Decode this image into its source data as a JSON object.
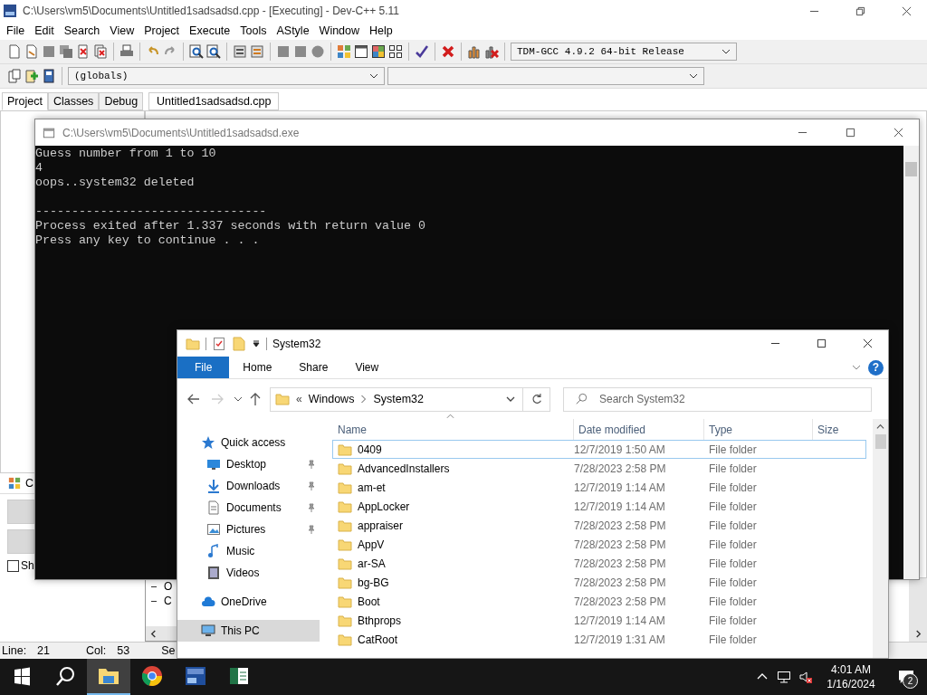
{
  "devcpp": {
    "title": "C:\\Users\\vm5\\Documents\\Untitled1sadsadsd.cpp - [Executing] - Dev-C++ 5.11",
    "menu": [
      "File",
      "Edit",
      "Search",
      "View",
      "Project",
      "Execute",
      "Tools",
      "AStyle",
      "Window",
      "Help"
    ],
    "compiler": "TDM-GCC 4.9.2 64-bit Release",
    "scope": "(globals)",
    "panel_tabs": [
      {
        "label": "Project",
        "selected": true
      },
      {
        "label": "Classes",
        "selected": false
      },
      {
        "label": "Debug",
        "selected": false
      }
    ],
    "editor_tabs": [
      {
        "label": "Untitled1sadsadsd.cpp",
        "selected": true
      }
    ],
    "lower_panel_label": "C",
    "show_checkbox": {
      "label": "Sh",
      "checked": false
    },
    "bottom_list": [
      "O",
      "C"
    ],
    "status_bar": {
      "line_label": "Line:",
      "line": "21",
      "col_label": "Col:",
      "col": "53",
      "section": "Se"
    }
  },
  "console": {
    "title": "C:\\Users\\vm5\\Documents\\Untitled1sadsadsd.exe",
    "blocks": [
      [
        "Guess number from 1 to 10",
        "4",
        "oops..system32 deleted"
      ],
      [
        "--------------------------------",
        "Process exited after 1.337 seconds with return value 0",
        "Press any key to continue . . ."
      ]
    ]
  },
  "explorer": {
    "title": "System32",
    "ribbon_tabs": [
      {
        "label": "File",
        "selected": true
      },
      {
        "label": "Home",
        "selected": false
      },
      {
        "label": "Share",
        "selected": false
      },
      {
        "label": "View",
        "selected": false
      }
    ],
    "help": "?",
    "path_overflow": "«",
    "path": [
      "Windows",
      "System32"
    ],
    "search": {
      "placeholder": "Search System32"
    },
    "columns": [
      "Name",
      "Date modified",
      "Type",
      "Size"
    ],
    "nav": [
      {
        "label": "Quick access",
        "kind": "star",
        "pinned": false,
        "selected": false
      },
      {
        "label": "Desktop",
        "kind": "desktop",
        "pinned": true,
        "selected": false
      },
      {
        "label": "Downloads",
        "kind": "download",
        "pinned": true,
        "selected": false
      },
      {
        "label": "Documents",
        "kind": "document",
        "pinned": true,
        "selected": false
      },
      {
        "label": "Pictures",
        "kind": "picture",
        "pinned": true,
        "selected": false
      },
      {
        "label": "Music",
        "kind": "music",
        "pinned": false,
        "selected": false
      },
      {
        "label": "Videos",
        "kind": "video",
        "pinned": false,
        "selected": false
      },
      {
        "label": "OneDrive",
        "kind": "cloud",
        "pinned": false,
        "selected": false
      },
      {
        "label": "This PC",
        "kind": "pc",
        "pinned": false,
        "selected": true
      }
    ],
    "rows": [
      {
        "name": "0409",
        "date": "12/7/2019 1:50 AM",
        "type": "File folder",
        "focused": true
      },
      {
        "name": "AdvancedInstallers",
        "date": "7/28/2023 2:58 PM",
        "type": "File folder",
        "focused": false
      },
      {
        "name": "am-et",
        "date": "12/7/2019 1:14 AM",
        "type": "File folder",
        "focused": false
      },
      {
        "name": "AppLocker",
        "date": "12/7/2019 1:14 AM",
        "type": "File folder",
        "focused": false
      },
      {
        "name": "appraiser",
        "date": "7/28/2023 2:58 PM",
        "type": "File folder",
        "focused": false
      },
      {
        "name": "AppV",
        "date": "7/28/2023 2:58 PM",
        "type": "File folder",
        "focused": false
      },
      {
        "name": "ar-SA",
        "date": "7/28/2023 2:58 PM",
        "type": "File folder",
        "focused": false
      },
      {
        "name": "bg-BG",
        "date": "7/28/2023 2:58 PM",
        "type": "File folder",
        "focused": false
      },
      {
        "name": "Boot",
        "date": "7/28/2023 2:58 PM",
        "type": "File folder",
        "focused": false
      },
      {
        "name": "Bthprops",
        "date": "12/7/2019 1:14 AM",
        "type": "File folder",
        "focused": false
      },
      {
        "name": "CatRoot",
        "date": "12/7/2019 1:31 AM",
        "type": "File folder",
        "focused": false
      }
    ]
  },
  "taskbar": {
    "apps": [
      {
        "kind": "explorer",
        "active": true
      },
      {
        "kind": "chrome",
        "active": false
      },
      {
        "kind": "devcpp",
        "active": false
      },
      {
        "kind": "sheet",
        "active": false
      }
    ],
    "time": "4:01 AM",
    "date": "1/16/2024",
    "notifications": "2"
  }
}
